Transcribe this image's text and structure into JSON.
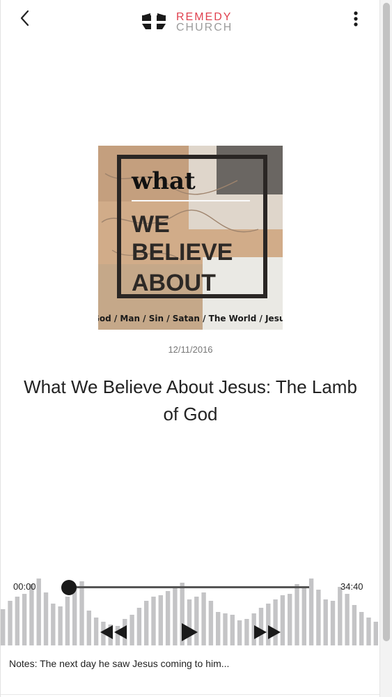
{
  "header": {
    "back_icon": "chevron-left-icon",
    "logo_line1": "REMEDY",
    "logo_line2": "CHURCH",
    "menu_icon": "more-vertical-icon"
  },
  "artwork": {
    "word1": "what",
    "word2": "WE",
    "word3": "BELIEVE",
    "word4": "ABOUT",
    "topics": "God / Man / Sin / Satan / The World / Jesus"
  },
  "sermon": {
    "date": "12/11/2016",
    "title": "What We Believe About Jesus: The Lamb of God",
    "notes": "Notes: The next day he saw Jesus coming to him..."
  },
  "player": {
    "time_start": "00:00",
    "time_end": "34:40",
    "progress": 0.0,
    "controls": [
      "rewind-icon",
      "play-icon",
      "fast-forward-icon"
    ]
  },
  "colors": {
    "brand_red": "#e0414f",
    "brand_gray": "#9c9c9c",
    "wave_bar": "#c4c4c6",
    "text_dark": "#222222"
  }
}
